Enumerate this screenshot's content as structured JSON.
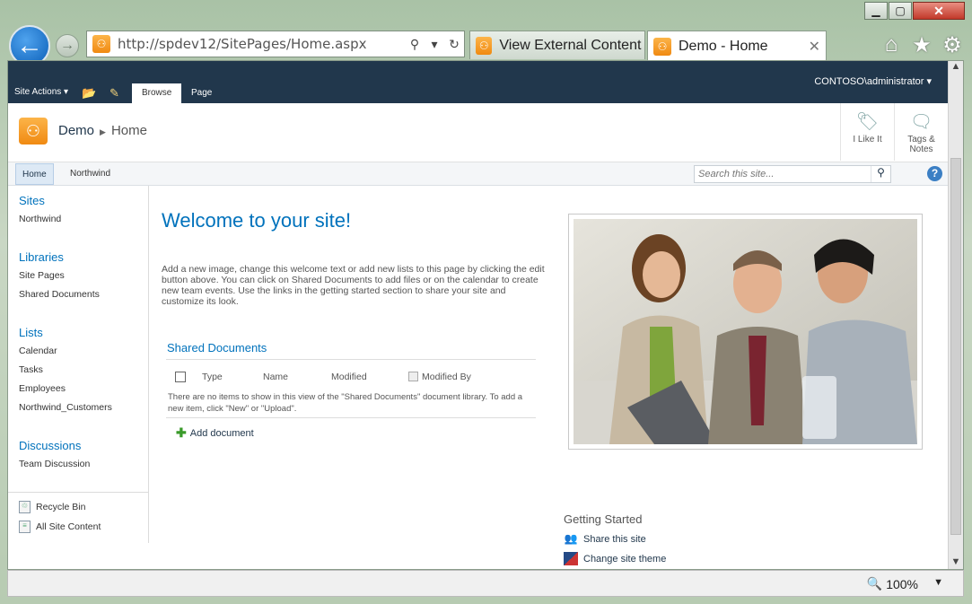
{
  "browser": {
    "url": "http://spdev12/SitePages/Home.aspx",
    "tabs": [
      {
        "label": "View External Content ..."
      },
      {
        "label": "Demo - Home"
      }
    ],
    "zoom": "100%"
  },
  "ribbon": {
    "site_actions": "Site Actions",
    "tabs": [
      "Browse",
      "Page"
    ],
    "user": "CONTOSO\\administrator"
  },
  "header": {
    "site": "Demo",
    "page": "Home",
    "like_label": "I Like It",
    "tags_label_1": "Tags &",
    "tags_label_2": "Notes"
  },
  "topnav": {
    "items": [
      "Home",
      "Northwind"
    ],
    "search_placeholder": "Search this site..."
  },
  "quicklaunch": {
    "sites_head": "Sites",
    "sites": [
      "Northwind"
    ],
    "libraries_head": "Libraries",
    "libraries": [
      "Site Pages",
      "Shared Documents"
    ],
    "lists_head": "Lists",
    "lists": [
      "Calendar",
      "Tasks",
      "Employees",
      "Northwind_Customers"
    ],
    "discussions_head": "Discussions",
    "discussions": [
      "Team Discussion"
    ],
    "recycle_bin": "Recycle Bin",
    "all_content": "All Site Content"
  },
  "main": {
    "welcome": "Welcome to your site!",
    "intro": "Add a new image, change this welcome text or add new lists to this page by clicking the edit button above. You can click on Shared Documents to add files or on the calendar to create new team events. Use the links in the getting started section to share your site and customize its look.",
    "shared_docs": {
      "title": "Shared Documents",
      "columns": [
        "Type",
        "Name",
        "Modified",
        "Modified By"
      ],
      "empty_message": "There are no items to show in this view of the \"Shared Documents\" document library. To add a new item, click \"New\" or \"Upload\".",
      "add_label": "Add document"
    },
    "getting_started": {
      "title": "Getting Started",
      "items": [
        "Share this site",
        "Change site theme"
      ]
    }
  },
  "colors": {
    "ribbon_bg": "#21374c",
    "link_blue": "#0072bc",
    "logo_orange": "#f08a12"
  }
}
